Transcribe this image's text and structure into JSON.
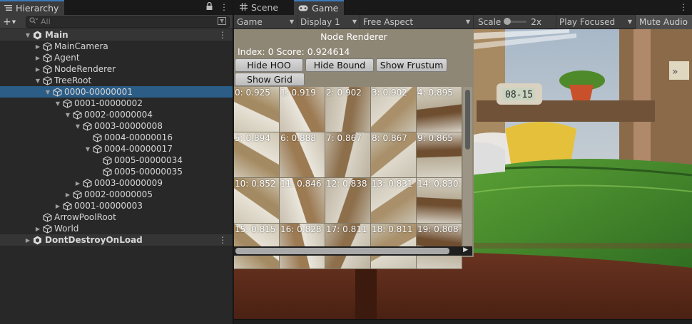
{
  "hierarchy": {
    "tab_label": "Hierarchy",
    "add_label": "+",
    "search_placeholder": "All",
    "rows": [
      {
        "label": "Main",
        "depth": 0,
        "kind": "scene",
        "arrow": "down",
        "menu": true
      },
      {
        "label": "MainCamera",
        "depth": 1,
        "kind": "object",
        "arrow": "right"
      },
      {
        "label": "Agent",
        "depth": 1,
        "kind": "object",
        "arrow": "right"
      },
      {
        "label": "NodeRenderer",
        "depth": 1,
        "kind": "object",
        "arrow": "right"
      },
      {
        "label": "TreeRoot",
        "depth": 1,
        "kind": "object",
        "arrow": "down"
      },
      {
        "label": "0000-00000001",
        "depth": 2,
        "kind": "object",
        "arrow": "down",
        "selected": true
      },
      {
        "label": "0001-00000002",
        "depth": 3,
        "kind": "object",
        "arrow": "down"
      },
      {
        "label": "0002-00000004",
        "depth": 4,
        "kind": "object",
        "arrow": "down"
      },
      {
        "label": "0003-00000008",
        "depth": 5,
        "kind": "object",
        "arrow": "down"
      },
      {
        "label": "0004-00000016",
        "depth": 6,
        "kind": "object",
        "arrow": "none"
      },
      {
        "label": "0004-00000017",
        "depth": 6,
        "kind": "object",
        "arrow": "down"
      },
      {
        "label": "0005-00000034",
        "depth": 7,
        "kind": "object",
        "arrow": "none"
      },
      {
        "label": "0005-00000035",
        "depth": 7,
        "kind": "object",
        "arrow": "none"
      },
      {
        "label": "0003-00000009",
        "depth": 5,
        "kind": "object",
        "arrow": "right"
      },
      {
        "label": "0002-00000005",
        "depth": 4,
        "kind": "object",
        "arrow": "right"
      },
      {
        "label": "0001-00000003",
        "depth": 3,
        "kind": "object",
        "arrow": "right"
      },
      {
        "label": "ArrowPoolRoot",
        "depth": 1,
        "kind": "object",
        "arrow": "none"
      },
      {
        "label": "World",
        "depth": 1,
        "kind": "object",
        "arrow": "right"
      },
      {
        "label": "DontDestroyOnLoad",
        "depth": 0,
        "kind": "scene",
        "arrow": "right",
        "menu": true
      }
    ]
  },
  "game": {
    "tabs": [
      {
        "label": "Scene",
        "active": false
      },
      {
        "label": "Game",
        "active": true
      }
    ],
    "toolbar": {
      "mode": "Game",
      "display": "Display 1",
      "aspect": "Free Aspect",
      "scale_label": "Scale",
      "scale_value": "2x",
      "play_mode": "Play Focused",
      "mute": "Mute Audio"
    },
    "overlay": {
      "title": "Node Renderer",
      "score_text": "Index: 0 Score: 0.924614",
      "buttons": {
        "hide_hoo": "Hide HOO",
        "hide_bound": "Hide Bound",
        "show_frustum": "Show Frustum",
        "show_grid": "Show Grid"
      },
      "thumbnails": [
        "0: 0.925",
        "1: 0.919",
        "2: 0.902",
        "3: 0.902",
        "4: 0.895",
        "5: 0.894",
        "6: 0.888",
        "7: 0.867",
        "8: 0.867",
        "9: 0.865",
        "10: 0.852",
        "11: 0.846",
        "12: 0.838",
        "13: 0.831",
        "14: 0.830",
        "15: 0.815",
        "16: 0.828",
        "17: 0.811",
        "18: 0.811",
        "19: 0.808"
      ]
    },
    "scene_clock": "08-15"
  },
  "colors": {
    "selection": "#2c5d87",
    "tab_accent": "#3a79bb",
    "panel_bg": "#282828"
  }
}
